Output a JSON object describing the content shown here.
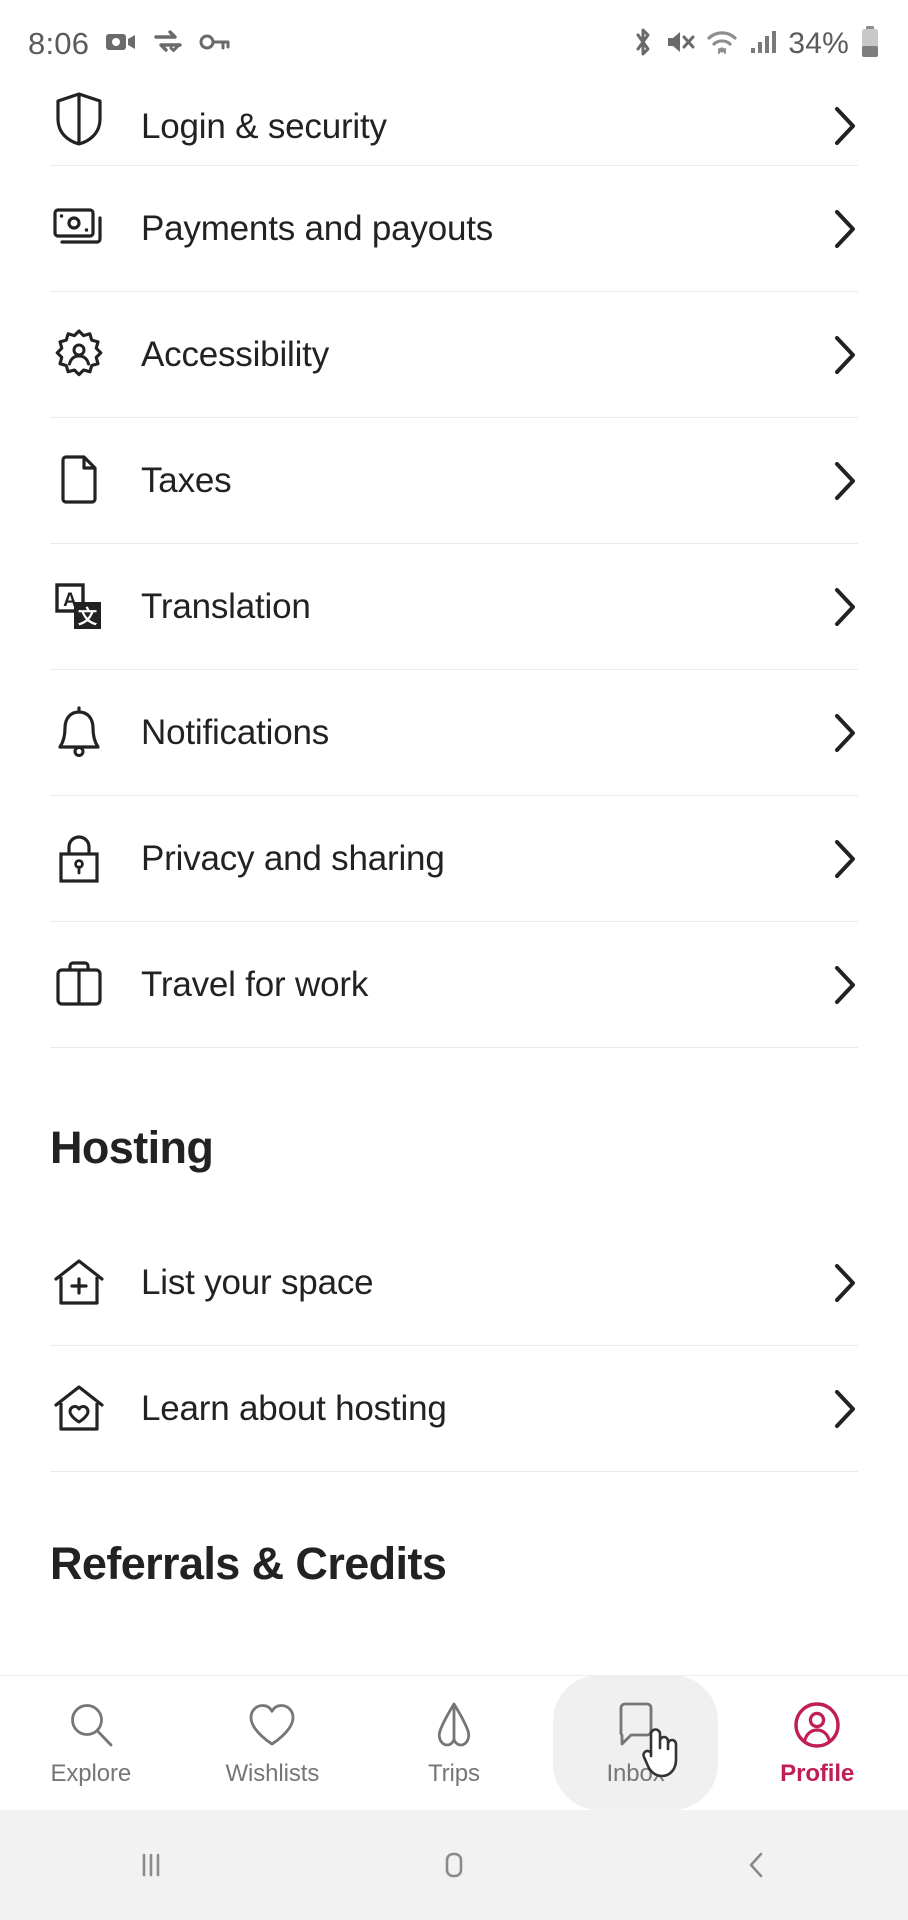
{
  "status_bar": {
    "time": "8:06",
    "battery_percent": "34%",
    "left_icons": [
      "video-camera-icon",
      "vpn-icon",
      "key-icon"
    ],
    "right_icons": [
      "bluetooth-icon",
      "mute-icon",
      "wifi-icon",
      "cellular-signal-icon",
      "battery-icon"
    ]
  },
  "settings": {
    "items": [
      {
        "label": "Login & security",
        "icon": "shield-icon"
      },
      {
        "label": "Payments and payouts",
        "icon": "banknotes-icon"
      },
      {
        "label": "Accessibility",
        "icon": "gear-person-icon"
      },
      {
        "label": "Taxes",
        "icon": "document-icon"
      },
      {
        "label": "Translation",
        "icon": "translation-icon"
      },
      {
        "label": "Notifications",
        "icon": "bell-icon"
      },
      {
        "label": "Privacy and sharing",
        "icon": "lock-icon"
      },
      {
        "label": "Travel for work",
        "icon": "briefcase-icon"
      }
    ]
  },
  "hosting": {
    "title": "Hosting",
    "items": [
      {
        "label": "List your space",
        "icon": "house-plus-icon"
      },
      {
        "label": "Learn about hosting",
        "icon": "house-heart-icon"
      }
    ]
  },
  "referrals": {
    "title": "Referrals & Credits"
  },
  "tab_bar": {
    "active_color": "#C01F54",
    "inactive_color": "#767676",
    "tabs": [
      {
        "label": "Explore",
        "icon": "search-icon",
        "active": false,
        "highlighted": false
      },
      {
        "label": "Wishlists",
        "icon": "heart-icon",
        "active": false,
        "highlighted": false
      },
      {
        "label": "Trips",
        "icon": "airbnb-bellhop-icon",
        "active": false,
        "highlighted": false
      },
      {
        "label": "Inbox",
        "icon": "message-bubble-icon",
        "active": false,
        "highlighted": true
      },
      {
        "label": "Profile",
        "icon": "user-circle-icon",
        "active": true,
        "highlighted": false
      }
    ]
  },
  "android_nav": {
    "buttons": [
      "recents-icon",
      "home-icon",
      "back-icon"
    ]
  }
}
